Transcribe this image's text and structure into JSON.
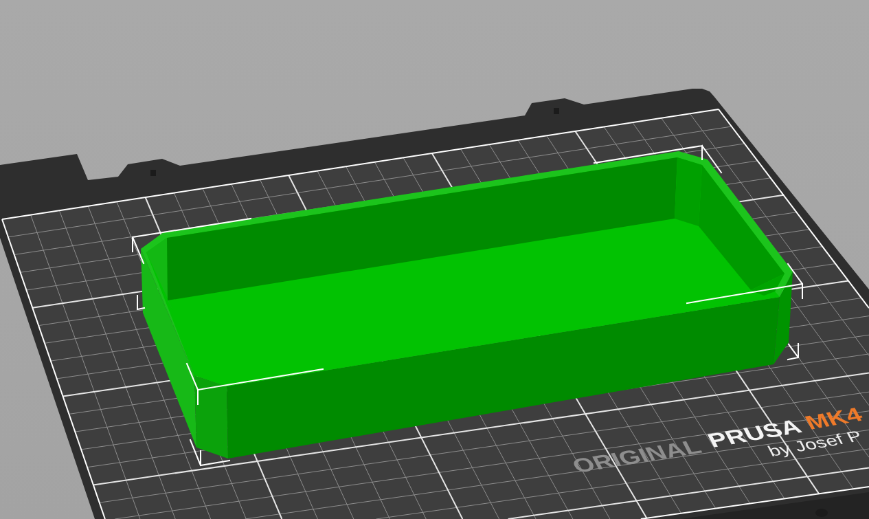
{
  "viewport": {
    "print_bed": {
      "logo": [
        {
          "text": "ORIGINAL",
          "kind": "muted"
        },
        {
          "text": "PRUSA",
          "kind": "main"
        },
        {
          "text": "MK4",
          "kind": "accent"
        }
      ],
      "byline": "by Josef P"
    },
    "model": {
      "selected": true
    }
  }
}
